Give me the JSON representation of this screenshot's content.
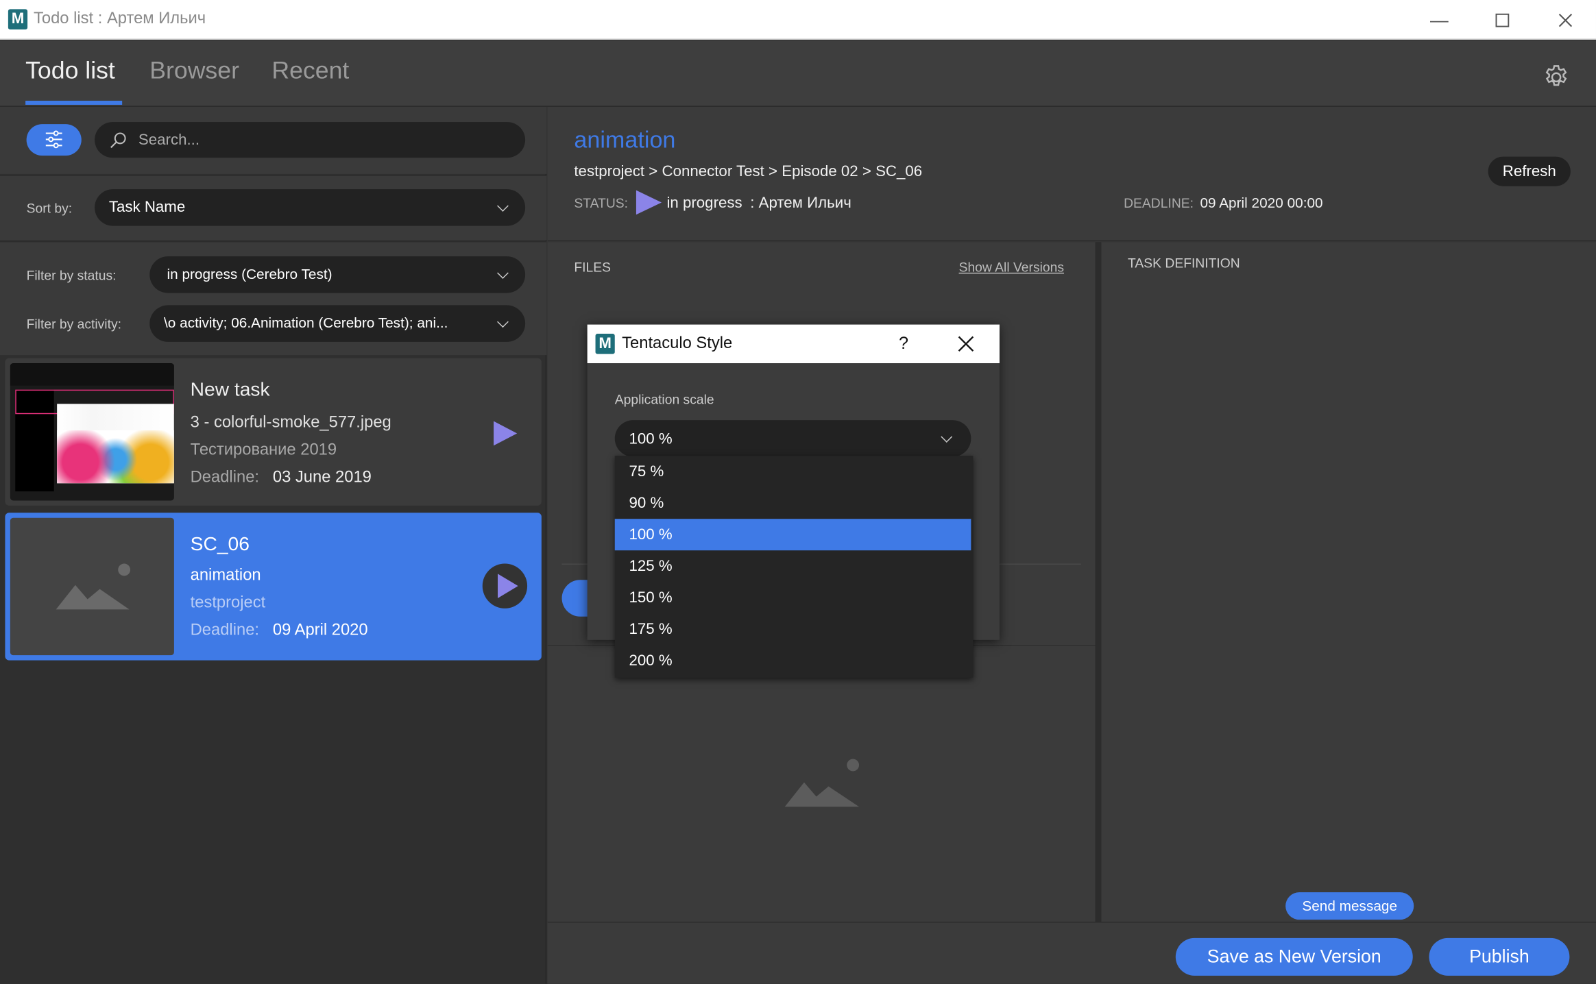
{
  "window": {
    "title": "Todo list : Артем Ильич",
    "app_icon_letter": "M"
  },
  "tabs": [
    {
      "label": "Todo list",
      "active": true
    },
    {
      "label": "Browser",
      "active": false
    },
    {
      "label": "Recent",
      "active": false
    }
  ],
  "search": {
    "placeholder": "Search..."
  },
  "sort": {
    "label": "Sort by:",
    "value": "Task Name"
  },
  "filter_status": {
    "label": "Filter by status:",
    "value": "in progress (Cerebro Test)"
  },
  "filter_activity": {
    "label": "Filter by activity:",
    "value": "\\o activity; 06.Animation (Cerebro Test); ani..."
  },
  "tasks": [
    {
      "name": "New task",
      "line2": "3 - colorful-smoke_577.jpeg",
      "line3": "Тестирование 2019",
      "deadline_label": "Deadline:",
      "deadline": "03 June 2019"
    },
    {
      "name": "SC_06",
      "line2": "animation",
      "line3": "testproject",
      "deadline_label": "Deadline:",
      "deadline": "09 April 2020"
    }
  ],
  "detail": {
    "activity": "animation",
    "path": "testproject > Connector Test > Episode 02 > SC_06",
    "status_label": "STATUS:",
    "status_value": "in progress",
    "status_user": ": Артем Ильич",
    "deadline_label": "DEADLINE:",
    "deadline_value": "09 April 2020 00:00",
    "refresh": "Refresh"
  },
  "files": {
    "header": "FILES",
    "show_all": "Show All Versions"
  },
  "task_definition": {
    "header": "TASK DEFINITION"
  },
  "buttons": {
    "send_message": "Send message",
    "save_new_version": "Save as New Version",
    "publish": "Publish"
  },
  "dialog": {
    "title": "Tentaculo Style",
    "help": "?",
    "scale_label": "Application scale",
    "scale_value": "100 %",
    "options": [
      "75 %",
      "90 %",
      "100 %",
      "125 %",
      "150 %",
      "175 %",
      "200 %"
    ],
    "selected_index": 2
  },
  "colors": {
    "accent": "#3f7ae6",
    "status_triangle": "#8b84e8",
    "background": "#353535"
  }
}
